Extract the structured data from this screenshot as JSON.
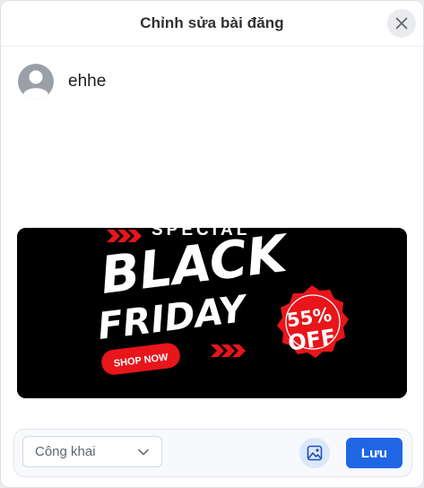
{
  "dialog": {
    "title": "Chỉnh sửa bài đăng",
    "close_icon": "close-icon"
  },
  "post": {
    "username": "ehhe",
    "avatar_icon": "default-avatar-icon",
    "image": {
      "alt": "Black Friday promotion banner",
      "text_special": "SPECIAL",
      "text_black": "BLACK",
      "text_friday": "FRIDAY",
      "badge_line1": "55%",
      "badge_line2": "OFF",
      "cta": "SHOP NOW"
    }
  },
  "footer": {
    "privacy_value": "Công khai",
    "privacy_icon": "chevron-down-icon",
    "image_icon": "image-icon",
    "save_label": "Lưu"
  },
  "colors": {
    "accent": "#1f66e5",
    "image_button_bg": "#dbe7fb",
    "banner_red": "#e8151b"
  }
}
